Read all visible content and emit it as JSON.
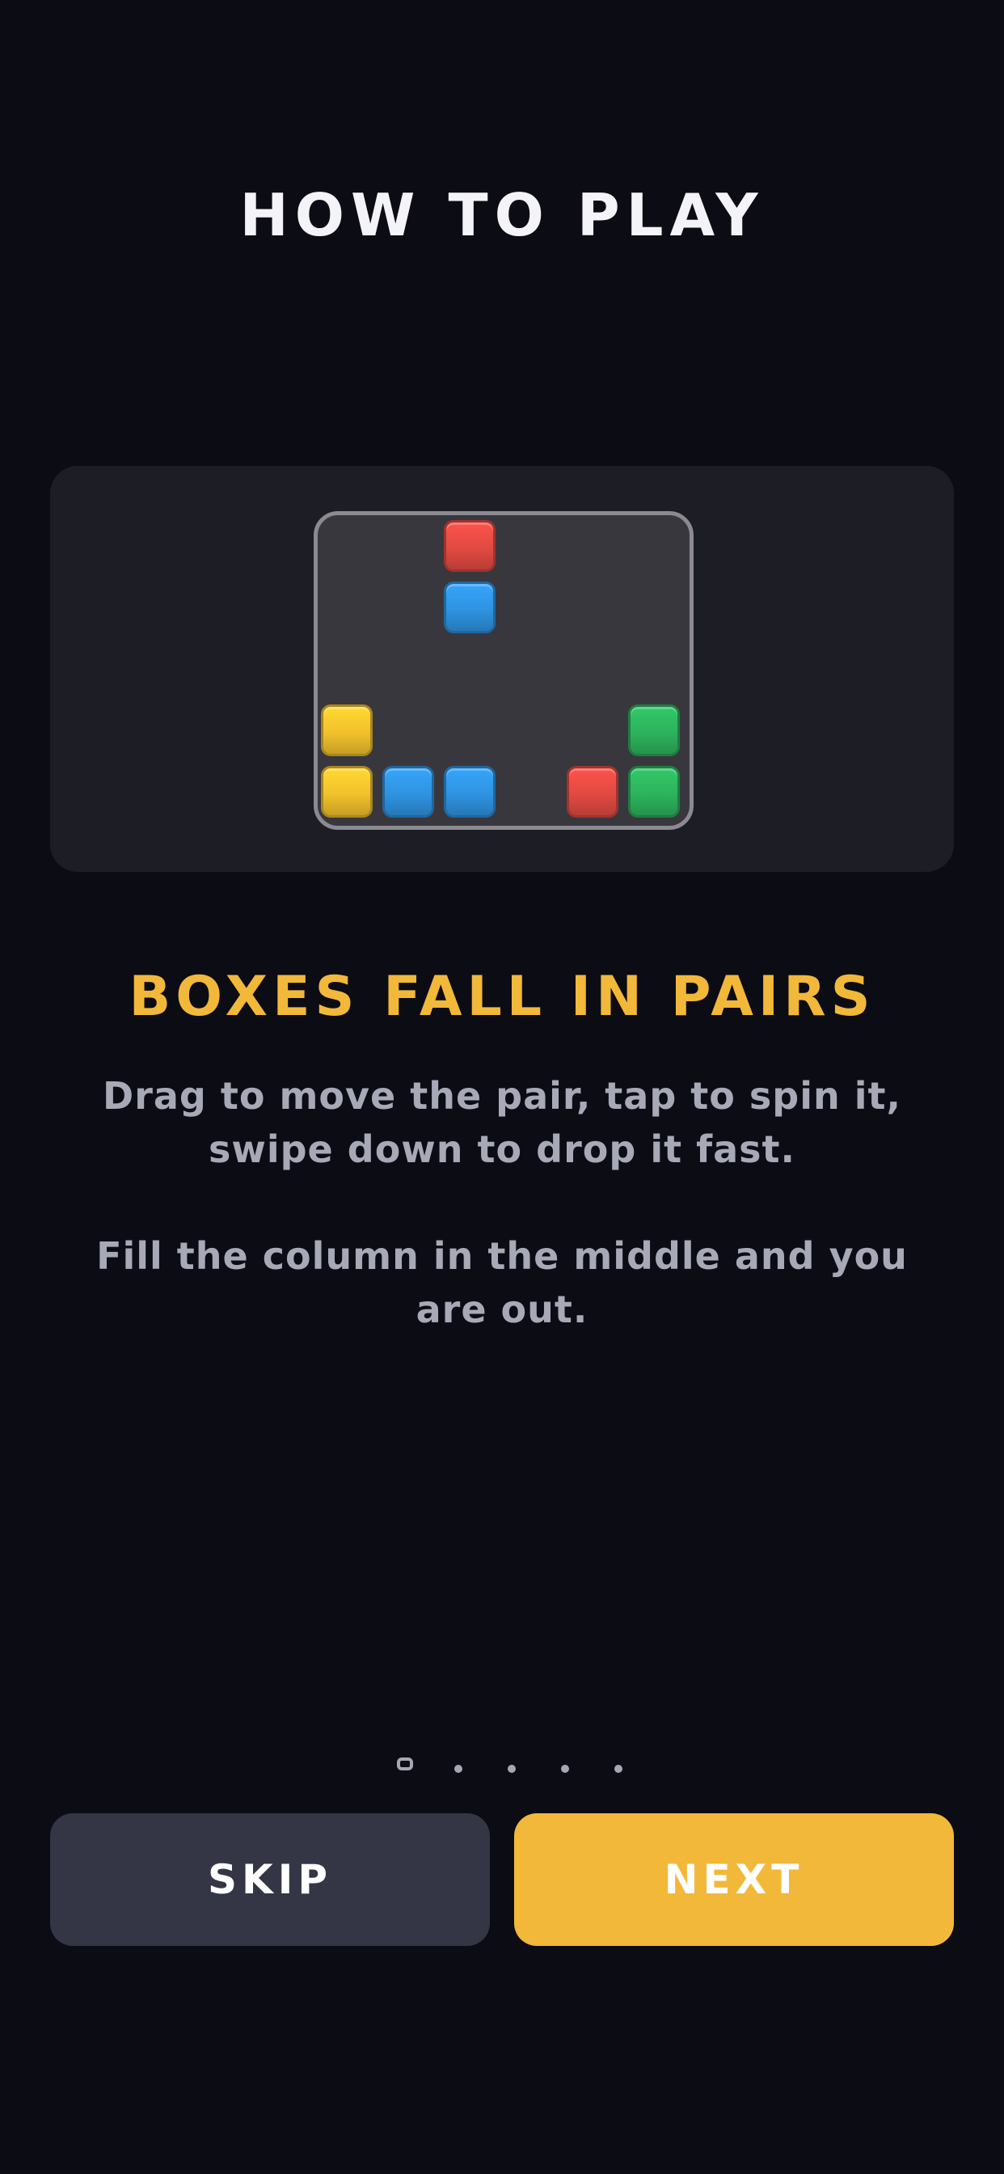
{
  "screen": {
    "title": "HOW TO PLAY"
  },
  "tutorial": {
    "heading": "BOXES FALL IN PAIRS",
    "paragraph_1": "Drag to move the pair, tap to spin it, swipe down to drop it fast.",
    "paragraph_2": "Fill the column in the middle and you are out."
  },
  "board": {
    "columns": 6,
    "rows": 5,
    "blocks": [
      {
        "col": 2,
        "row": 0,
        "color": "red"
      },
      {
        "col": 2,
        "row": 1,
        "color": "blue"
      },
      {
        "col": 0,
        "row": 3,
        "color": "yellow"
      },
      {
        "col": 5,
        "row": 3,
        "color": "green"
      },
      {
        "col": 0,
        "row": 4,
        "color": "yellow"
      },
      {
        "col": 1,
        "row": 4,
        "color": "blue"
      },
      {
        "col": 2,
        "row": 4,
        "color": "blue"
      },
      {
        "col": 4,
        "row": 4,
        "color": "red"
      },
      {
        "col": 5,
        "row": 4,
        "color": "green"
      }
    ]
  },
  "pager": {
    "total": 5,
    "current": 1
  },
  "buttons": {
    "skip_label": "SKIP",
    "next_label": "NEXT"
  },
  "colors": {
    "background": "#0c0c14",
    "accent": "#f2b83a",
    "card": "#1d1d25",
    "board": "#39373e",
    "block_red": "#e14a42",
    "block_blue": "#2f93e0",
    "block_yellow": "#f2c12c",
    "block_green": "#2db35d"
  }
}
